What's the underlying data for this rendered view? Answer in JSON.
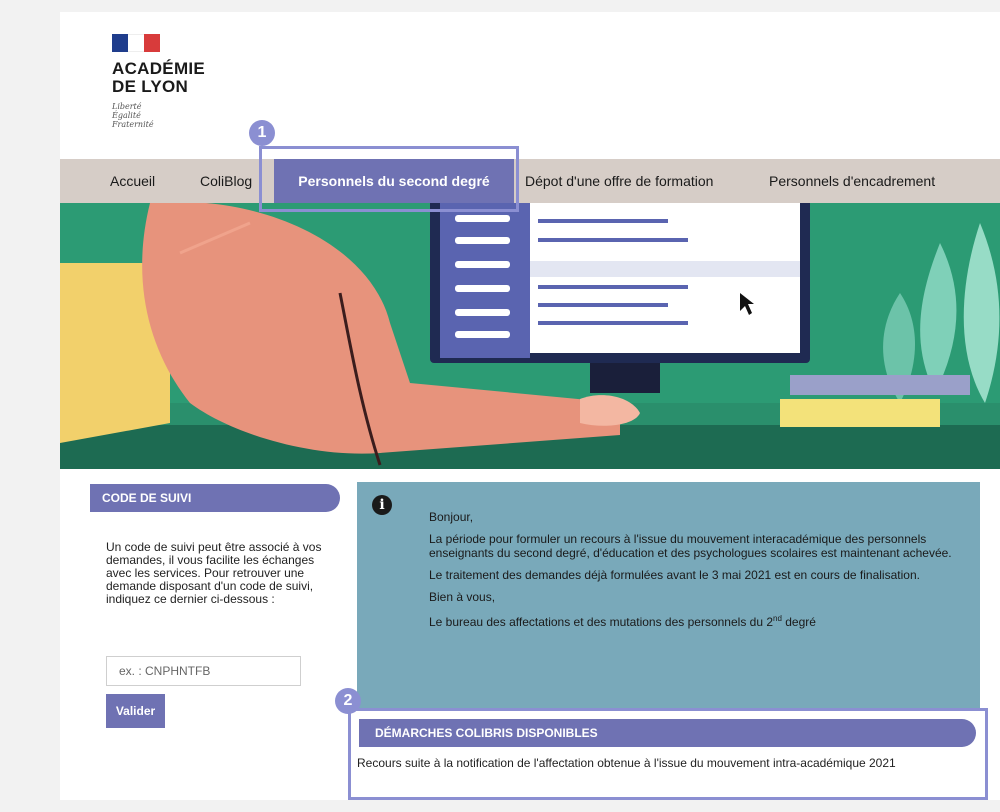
{
  "header": {
    "logo_title_line1": "ACADÉMIE",
    "logo_title_line2": "DE LYON",
    "motto": [
      "Liberté",
      "Égalité",
      "Fraternité"
    ]
  },
  "nav": {
    "items": [
      {
        "label": "Accueil"
      },
      {
        "label": "ColiBlog"
      },
      {
        "label": "Personnels du second degré"
      },
      {
        "label": "Dépot d'une offre de formation"
      },
      {
        "label": "Personnels d'encadrement"
      }
    ],
    "active_index": 2
  },
  "sidebar": {
    "heading": "CODE DE SUIVI",
    "description": "Un code de suivi peut être associé à vos demandes, il vous facilite les échanges avec les services. Pour retrouver une demande disposant d'un code de suivi, indiquez ce dernier ci-dessous :",
    "input_value": "",
    "input_placeholder": "ex. : CNPHNTFB",
    "button_label": "Valider"
  },
  "info": {
    "icon": "info-circle-icon",
    "greeting": "Bonjour,",
    "para1": "La période pour formuler un recours à l'issue du mouvement interacadémique  des personnels enseignants du second degré, d'éducation et des psychologues scolaires est maintenant achevée.",
    "para2": "Le traitement des demandes déjà formulées avant le 3 mai 2021 est en cours de finalisation.",
    "closing": "Bien à vous,",
    "signature_prefix": "Le bureau des affectations et des mutations des personnels du 2",
    "signature_sup": "nd",
    "signature_suffix": " degré"
  },
  "demarches": {
    "heading": "DÉMARCHES COLIBRIS DISPONIBLES",
    "link_text": "Recours suite à la notification de l'affectation obtenue à l'issue du mouvement intra-académique 2021"
  },
  "annotations": {
    "badge1": "1",
    "badge2": "2"
  },
  "colors": {
    "accent": "#6f72b3",
    "highlight": "#8b8fd2",
    "info_bg": "#79a9ba",
    "nav_bg": "#d6cdc7"
  }
}
